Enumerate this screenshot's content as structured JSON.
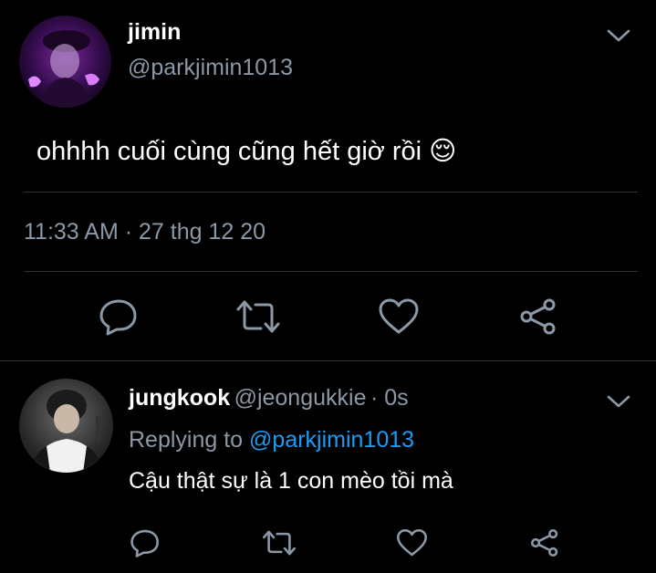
{
  "tweet": {
    "name": "jimin",
    "handle": "@parkjimin1013",
    "text": "ohhhh cuối cùng cũng hết giờ rồi 😌",
    "timestamp": "11:33 AM · 27 thg 12 20",
    "actions": [
      "reply-icon",
      "retweet-icon",
      "like-icon",
      "share-icon"
    ]
  },
  "reply": {
    "name": "jungkook",
    "handle": "@jeongukkie",
    "time": "· 0s",
    "replying_prefix": "Replying to",
    "replying_to": "@parkjimin1013",
    "text": "Cậu thật sự là 1 con mèo tồi mà",
    "actions": [
      "reply-icon",
      "retweet-icon",
      "like-icon",
      "share-icon"
    ]
  },
  "colors": {
    "background": "#000000",
    "secondary_text": "#8b98a5",
    "link": "#1d9bf0",
    "divider": "#2f3336"
  }
}
